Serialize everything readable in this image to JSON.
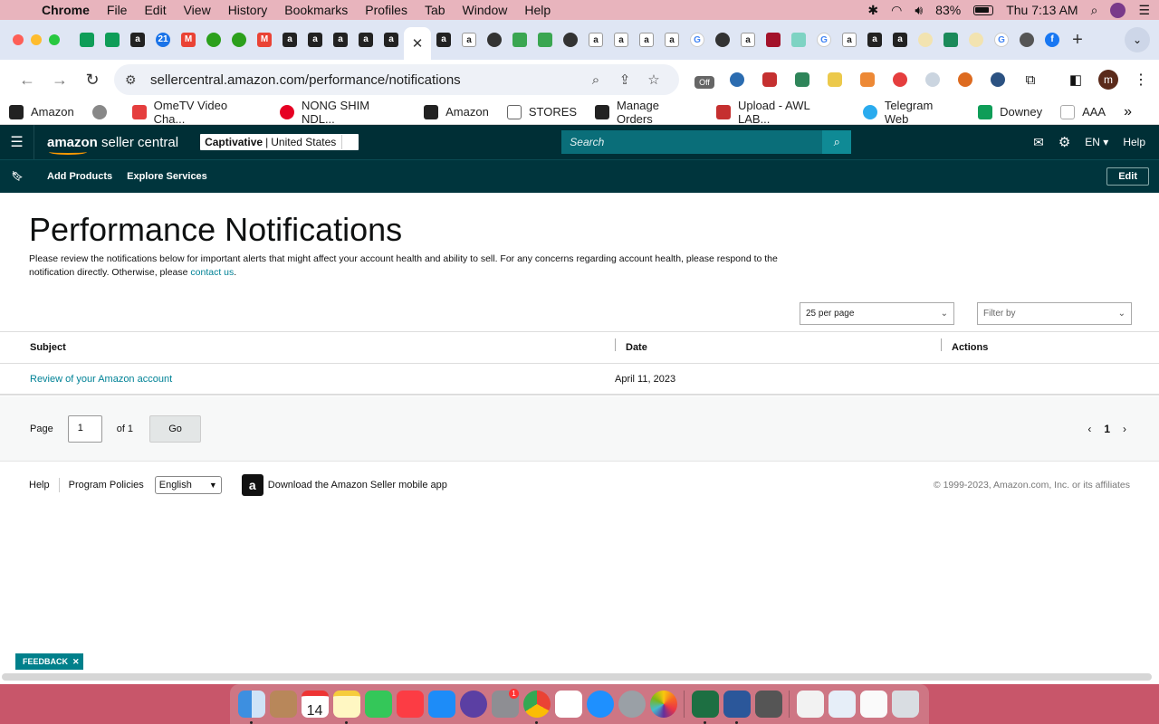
{
  "menubar": {
    "app": "Chrome",
    "items": [
      "File",
      "Edit",
      "View",
      "History",
      "Bookmarks",
      "Profiles",
      "Tab",
      "Window",
      "Help"
    ],
    "battery": "83%",
    "clock": "Thu 7:13 AM"
  },
  "browser": {
    "url": "sellercentral.amazon.com/performance/notifications",
    "tab_badge": "21",
    "extension_badge": "Off",
    "profile_initial": "m",
    "bookmarks": [
      "Amazon",
      "OmeTV Video Cha...",
      "NONG SHIM NDL...",
      "Amazon",
      "STORES",
      "Manage Orders",
      "Upload - AWL LAB...",
      "Telegram Web",
      "Downey",
      "AAA"
    ]
  },
  "sc_header": {
    "logo_brand": "amazon",
    "logo_text": "seller central",
    "store_name": "Captivative",
    "marketplace": "United States",
    "search_placeholder": "Search",
    "language": "EN",
    "help": "Help",
    "subnav": [
      "Add Products",
      "Explore Services"
    ],
    "edit": "Edit"
  },
  "page": {
    "title": "Performance Notifications",
    "description": "Please review the notifications below for important alerts that might affect your account health and ability to sell. For any concerns regarding account health, please respond to the notification directly. Otherwise, please",
    "contact_link": "contact us",
    "description_end": ".",
    "per_page": "25 per page",
    "filter_placeholder": "Filter by",
    "columns": [
      "Subject",
      "Date",
      "Actions"
    ],
    "rows": [
      {
        "subject": "Review of your Amazon account",
        "date": "April 11, 2023",
        "actions": ""
      }
    ],
    "pager": {
      "label": "Page",
      "current": "1",
      "of": "of 1",
      "go": "Go",
      "page_num": "1"
    }
  },
  "footer": {
    "help": "Help",
    "policies": "Program Policies",
    "language": "English",
    "app_download": "Download the Amazon Seller mobile app",
    "copyright": "© 1999-2023, Amazon.com, Inc. or its affiliates"
  },
  "feedback": "FEEDBACK",
  "dock_date": "14",
  "dock_badge": "1"
}
